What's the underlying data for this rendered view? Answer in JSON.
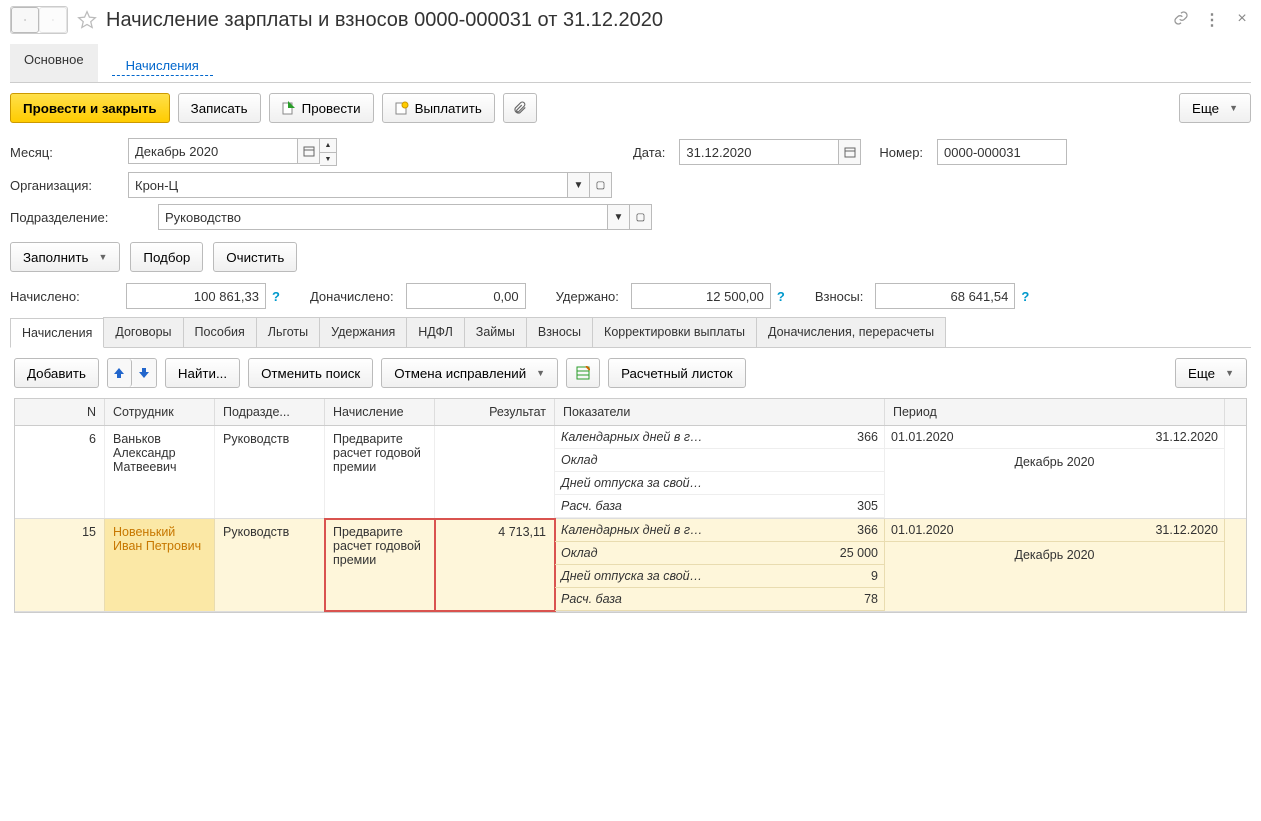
{
  "title": "Начисление зарплаты и взносов 0000-000031 от 31.12.2020",
  "topTabs": {
    "main": "Основное",
    "accruals": "Начисления"
  },
  "toolbar": {
    "postClose": "Провести и закрыть",
    "save": "Записать",
    "post": "Провести",
    "pay": "Выплатить",
    "more": "Еще"
  },
  "labels": {
    "month": "Месяц:",
    "date": "Дата:",
    "number": "Номер:",
    "org": "Организация:",
    "dept": "Подразделение:",
    "fill": "Заполнить",
    "pick": "Подбор",
    "clear": "Очистить",
    "accrued": "Начислено:",
    "addAccrued": "Доначислено:",
    "withheld": "Удержано:",
    "contrib": "Взносы:"
  },
  "fields": {
    "month": "Декабрь 2020",
    "date": "31.12.2020",
    "number": "0000-000031",
    "org": "Крон-Ц",
    "dept": "Руководство",
    "accrued": "100 861,33",
    "addAccrued": "0,00",
    "withheld": "12 500,00",
    "contrib": "68 641,54"
  },
  "sectionTabs": [
    "Начисления",
    "Договоры",
    "Пособия",
    "Льготы",
    "Удержания",
    "НДФЛ",
    "Займы",
    "Взносы",
    "Корректировки выплаты",
    "Доначисления, перерасчеты"
  ],
  "gridToolbar": {
    "add": "Добавить",
    "find": "Найти...",
    "cancelSearch": "Отменить поиск",
    "cancelFix": "Отмена исправлений",
    "payslip": "Расчетный листок",
    "more": "Еще"
  },
  "gridHeaders": {
    "n": "N",
    "emp": "Сотрудник",
    "dept": "Подразде...",
    "acc": "Начисление",
    "res": "Результат",
    "ind": "Показатели",
    "per": "Период"
  },
  "rows": [
    {
      "n": "6",
      "emp": "Ваньков Александр Матвеевич",
      "dept": "Руководств",
      "acc": "Предварите расчет годовой премии",
      "res": "",
      "indicators": [
        {
          "name": "Календарных дней в г…",
          "val": "366"
        },
        {
          "name": "Оклад",
          "val": ""
        },
        {
          "name": "Дней отпуска за свой…",
          "val": ""
        },
        {
          "name": "Расч. база",
          "val": "305"
        }
      ],
      "period": {
        "from": "01.01.2020",
        "to": "31.12.2020",
        "label": "Декабрь 2020"
      },
      "hl": false
    },
    {
      "n": "15",
      "emp": "Новенький Иван Петрович",
      "dept": "Руководств",
      "acc": "Предварите расчет годовой премии",
      "res": "4 713,11",
      "indicators": [
        {
          "name": "Календарных дней в г…",
          "val": "366"
        },
        {
          "name": "Оклад",
          "val": "25 000"
        },
        {
          "name": "Дней отпуска за свой…",
          "val": "9"
        },
        {
          "name": "Расч. база",
          "val": "78"
        }
      ],
      "period": {
        "from": "01.01.2020",
        "to": "31.12.2020",
        "label": "Декабрь 2020"
      },
      "hl": true
    }
  ]
}
